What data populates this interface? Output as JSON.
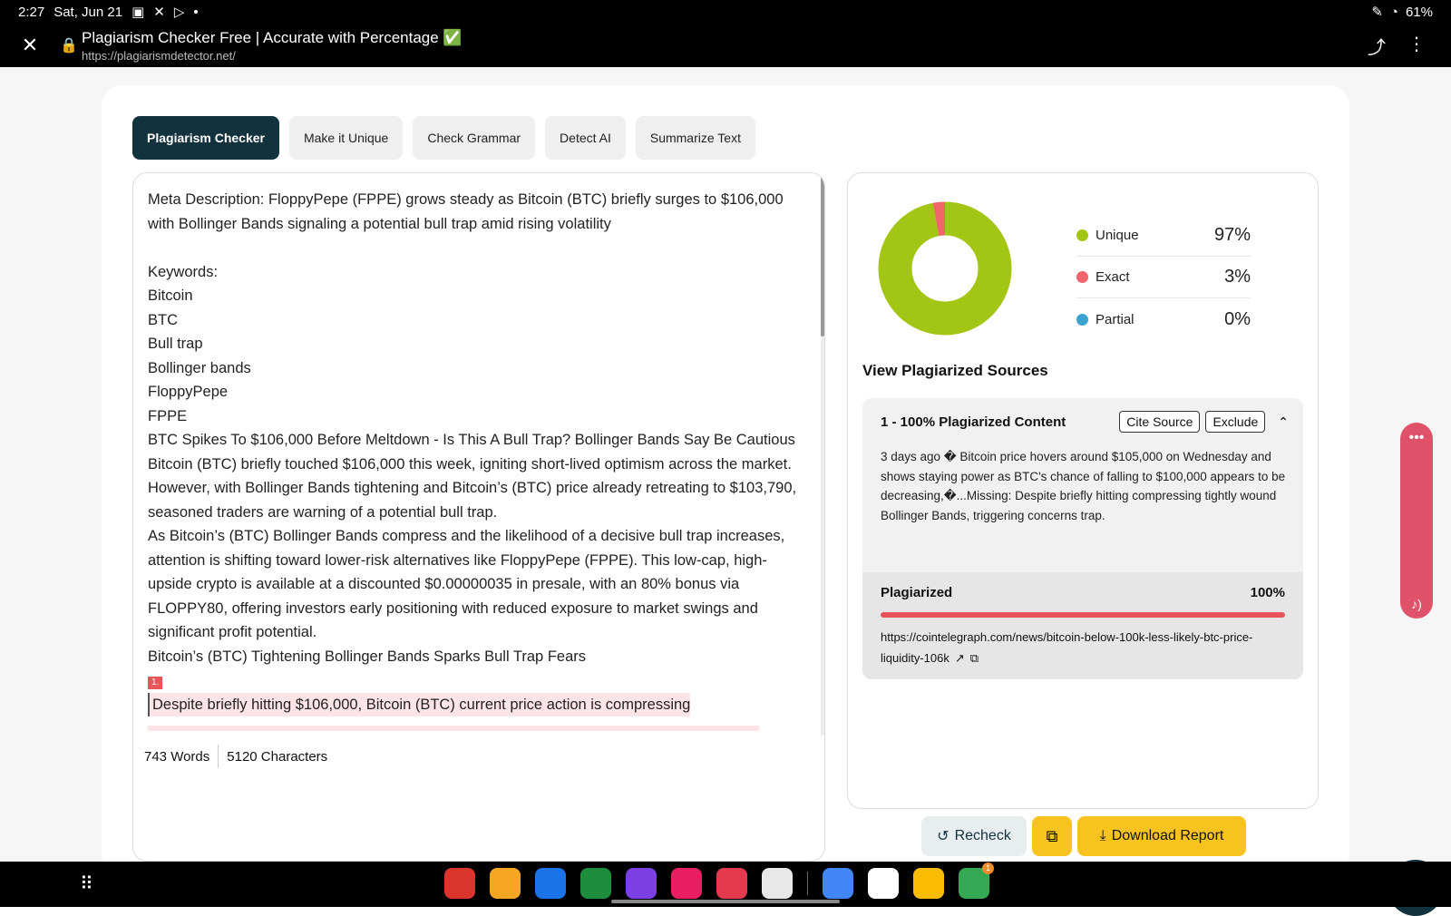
{
  "status": {
    "time": "2:27",
    "date": "Sat, Jun 21",
    "battery": "61%"
  },
  "browser": {
    "title": "Plagiarism Checker Free | Accurate with Percentage ✅",
    "url": "https://plagiarismdetector.net/"
  },
  "tabs": [
    "Plagiarism Checker",
    "Make it Unique",
    "Check Grammar",
    "Detect AI",
    "Summarize Text"
  ],
  "editor": {
    "lines": [
      "Meta Description: FloppyPepe (FPPE) grows steady as Bitcoin (BTC) briefly surges to $106,000 with Bollinger Bands signaling a potential bull trap amid rising volatility",
      "",
      "Keywords:",
      "Bitcoin",
      "BTC",
      "Bull trap",
      "Bollinger bands",
      "FloppyPepe",
      "FPPE",
      "BTC Spikes To $106,000 Before Meltdown - Is This A Bull Trap? Bollinger Bands Say Be Cautious",
      "Bitcoin (BTC) briefly touched $106,000 this week, igniting short-lived optimism across the market. However, with Bollinger Bands tightening and Bitcoin’s (BTC) price already retreating to $103,790, seasoned traders are warning of a potential bull trap.",
      "As Bitcoin’s (BTC) Bollinger Bands compress and the likelihood of a decisive bull trap increases, attention is shifting toward lower-risk alternatives like FloppyPepe (FPPE). This low-cap, high-upside crypto is available at a discounted $0.00000035 in presale, with an 80% bonus via FLOPPY80, offering investors early positioning with reduced exposure to market swings and significant profit potential.",
      "Bitcoin’s (BTC) Tightening Bollinger Bands Sparks Bull Trap Fears"
    ],
    "highlight_marker": "1.",
    "highlight_text": "Despite briefly hitting $106,000, Bitcoin (BTC) current price action is compressing",
    "words": "743 Words",
    "characters": "5120 Characters"
  },
  "results": {
    "legend": [
      {
        "name": "Unique",
        "pct": "97%",
        "color": "#a3c614"
      },
      {
        "name": "Exact",
        "pct": "3%",
        "color": "#f0646b"
      },
      {
        "name": "Partial",
        "pct": "0%",
        "color": "#3aa3d0"
      }
    ],
    "sources_title": "View Plagiarized Sources",
    "source": {
      "label": "1 - 100% Plagiarized Content",
      "cite": "Cite Source",
      "exclude": "Exclude",
      "text": "3 days ago � Bitcoin price hovers around $105,000 on Wednesday and shows staying power as BTC's chance of falling to $100,000 appears to be decreasing,�...Missing: Despite briefly hitting compressing tightly wound Bollinger Bands, triggering concerns trap.",
      "plag_label": "Plagiarized",
      "plag_value": "100%",
      "link": "https://cointelegraph.com/news/bitcoin-below-100k-less-likely-btc-price-liquidity-106k"
    }
  },
  "chart_data": {
    "type": "pie",
    "categories": [
      "Unique",
      "Exact",
      "Partial"
    ],
    "values": [
      97,
      3,
      0
    ],
    "colors": [
      "#a3c614",
      "#f0646b",
      "#3aa3d0"
    ]
  },
  "buttons": {
    "recheck": "Recheck",
    "download": "Download Report"
  },
  "dock_colors": [
    "#d9352c",
    "#f5a623",
    "#1a73e8",
    "#1e8e3e",
    "#7b3fe4",
    "#e91e63",
    "#e53950",
    "#e8e8e8",
    "#4285f4",
    "#ffffff",
    "#fbbc04",
    "#34a853"
  ],
  "dock_badge": "1"
}
